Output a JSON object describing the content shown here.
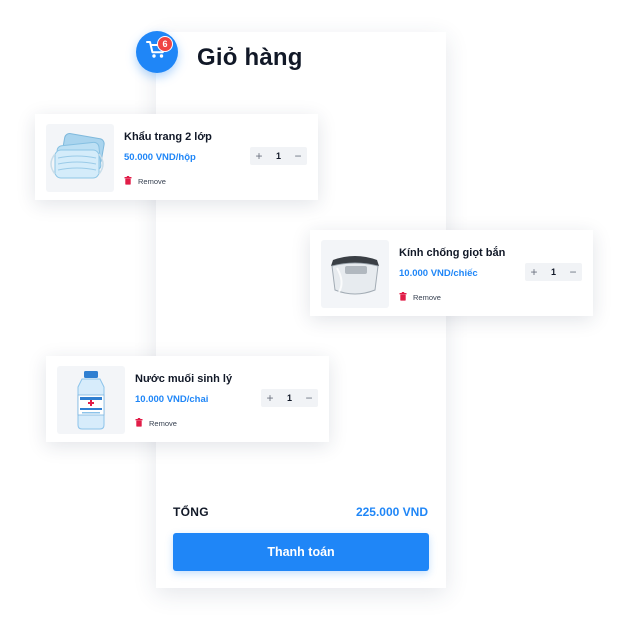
{
  "cart": {
    "title": "Giỏ hàng",
    "count": "6",
    "accent": "#1f86f7",
    "badge_color": "#ef4444"
  },
  "items": [
    {
      "name": "Khẩu trang 2 lớp",
      "price": "50.000 VND/hộp",
      "quantity": "1",
      "remove_label": "Remove",
      "image": "surgical-mask-image"
    },
    {
      "name": "Kính chống giọt bắn",
      "price": "10.000 VND/chiếc",
      "quantity": "1",
      "remove_label": "Remove",
      "image": "face-shield-image"
    },
    {
      "name": "Nước muối sinh lý",
      "price": "10.000 VND/chai",
      "quantity": "1",
      "remove_label": "Remove",
      "image": "saline-bottle-image"
    }
  ],
  "summary": {
    "total_label": "TỔNG",
    "total_value": "225.000 VND",
    "checkout_label": "Thanh toán"
  }
}
